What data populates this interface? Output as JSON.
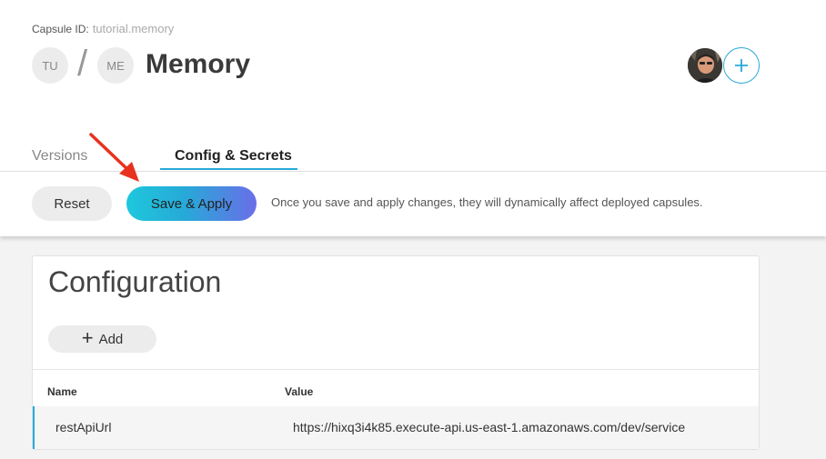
{
  "header": {
    "capsule_id_label": "Capsule ID:",
    "capsule_id_value": "tutorial.memory",
    "breadcrumb_initials_1": "TU",
    "breadcrumb_separator": "/",
    "breadcrumb_initials_2": "ME",
    "title": "Memory"
  },
  "tabs": [
    {
      "label": "Versions",
      "active": false
    },
    {
      "label": "Config & Secrets",
      "active": true
    }
  ],
  "actionbar": {
    "reset_label": "Reset",
    "save_label": "Save & Apply",
    "hint": "Once you save and apply changes, they will dynamically affect deployed capsules."
  },
  "configuration": {
    "title": "Configuration",
    "add_label": "Add",
    "columns": {
      "name": "Name",
      "value": "Value"
    },
    "rows": [
      {
        "name": "restApiUrl",
        "value": "https://hixq3i4k85.execute-api.us-east-1.amazonaws.com/dev/service"
      }
    ]
  },
  "icons": {
    "annotation_arrow": "red-arrow-icon",
    "add_collaborator": "plus-icon"
  },
  "colors": {
    "accent": "#27a9d8",
    "arrow": "#e8321e"
  }
}
